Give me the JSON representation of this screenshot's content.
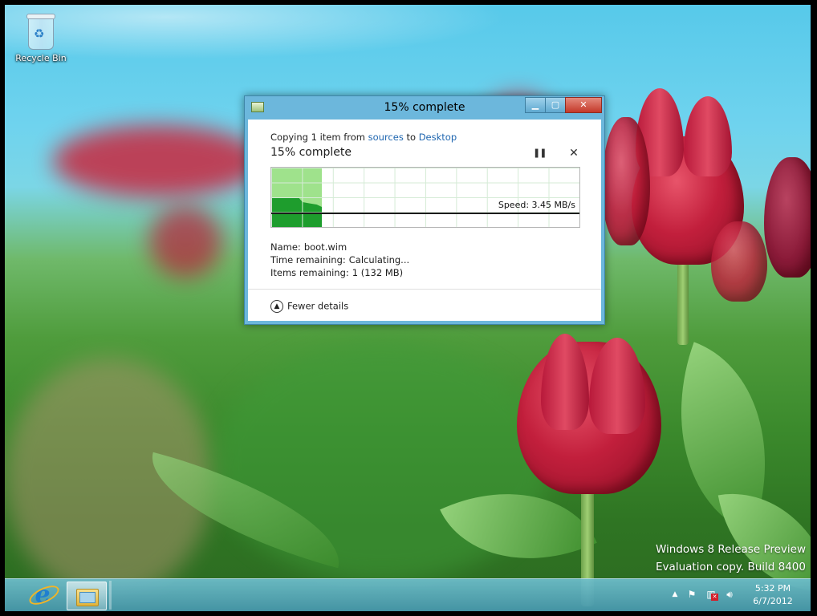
{
  "desktop": {
    "icons": [
      {
        "label": "Recycle Bin",
        "icon": "recycle-bin-icon"
      }
    ],
    "watermark": {
      "line1": "Windows 8 Release Preview",
      "line2": "Evaluation copy. Build 8400"
    }
  },
  "dialog": {
    "title": "15% complete",
    "title_buttons": [
      "minimize",
      "maximize",
      "close"
    ],
    "copying_prefix": "Copying 1 item from",
    "source": "sources",
    "to_word": "to",
    "destination": "Desktop",
    "percent_heading": "15% complete",
    "progress_fraction": 0.15,
    "speed": "Speed: 3.45 MB/s",
    "details": {
      "name_label": "Name:",
      "name_value": "boot.wim",
      "time_label": "Time remaining:",
      "time_value": "Calculating...",
      "items_label": "Items remaining:",
      "items_value": "1 (132 MB)"
    },
    "fewer_details": "Fewer details",
    "colors": {
      "graph_fill": "#9fe28c",
      "graph_area": "#1e9d2d",
      "accent_link": "#1f66b0"
    }
  },
  "taskbar": {
    "pinned": [
      {
        "name": "internet-explorer",
        "icon": "ie-icon"
      },
      {
        "name": "file-explorer",
        "icon": "folder-icon",
        "active": true
      }
    ],
    "clock": {
      "time": "5:32 PM",
      "date": "6/7/2012"
    }
  }
}
